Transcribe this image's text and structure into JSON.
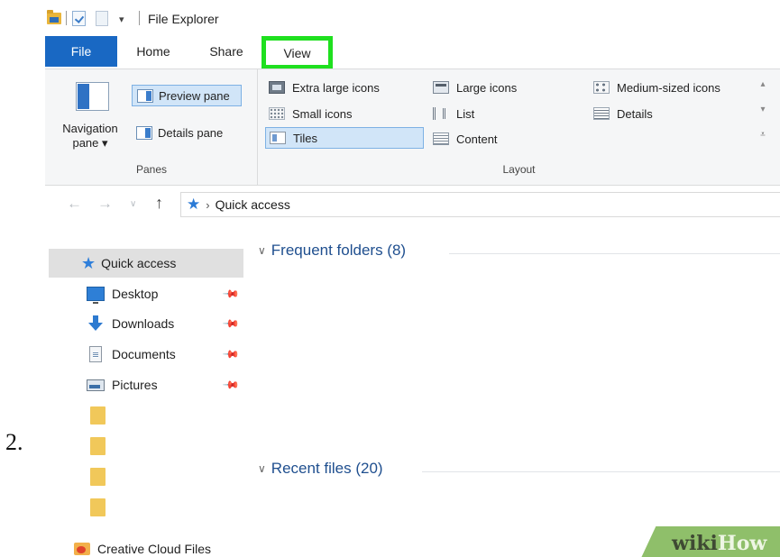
{
  "step_number": "2.",
  "window": {
    "title": "File Explorer"
  },
  "ribbon_tabs": {
    "file": "File",
    "home": "Home",
    "share": "Share",
    "view": "View",
    "highlight_color": "#1fe01f",
    "file_tab_color": "#1968c3"
  },
  "panes_group": {
    "navigation_pane_line1": "Navigation",
    "navigation_pane_line2": "pane ▾",
    "preview_pane": "Preview pane",
    "details_pane": "Details pane",
    "group_label": "Panes"
  },
  "layout_group": {
    "items": [
      "Extra large icons",
      "Large icons",
      "Medium-sized icons",
      "Small icons",
      "List",
      "Details",
      "Tiles",
      "Content"
    ],
    "selected": "Tiles",
    "group_label": "Layout"
  },
  "address_bar": {
    "location": "Quick access",
    "separator": "›"
  },
  "navigation": {
    "quick_access": "Quick access",
    "items": [
      "Desktop",
      "Downloads",
      "Documents",
      "Pictures"
    ],
    "creative_cloud": "Creative Cloud Files"
  },
  "content": {
    "frequent_folders": "Frequent folders (8)",
    "recent_files": "Recent files (20)"
  },
  "watermark": {
    "part1": "wiki",
    "part2": "How"
  }
}
